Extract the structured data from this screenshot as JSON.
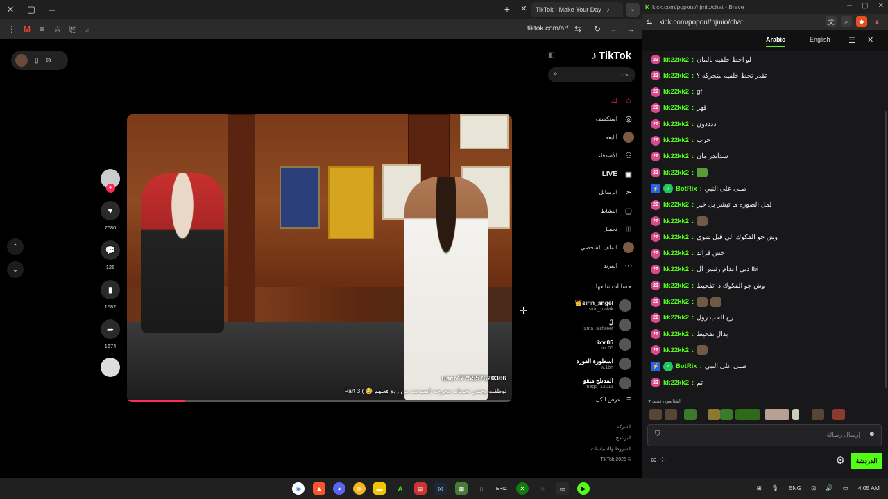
{
  "browser_left": {
    "tab_title": "TikTok - Make Your Day",
    "url": "tiktok.com/ar/"
  },
  "tiktok": {
    "logo": "TikTok",
    "search_placeholder": "بحث",
    "nav": [
      {
        "label": "لك",
        "icon": "home-icon"
      },
      {
        "label": "استكشف",
        "icon": "compass-icon"
      },
      {
        "label": "أتابعه",
        "icon": "avatar-icon"
      },
      {
        "label": "الأصدقاء",
        "icon": "friends-icon"
      },
      {
        "label": "LIVE",
        "icon": "live-icon"
      },
      {
        "label": "الرسائل",
        "icon": "send-icon"
      },
      {
        "label": "النشاط",
        "icon": "activity-icon"
      },
      {
        "label": "تحميل",
        "icon": "upload-icon"
      },
      {
        "label": "الملف الشخصي",
        "icon": "profile-icon"
      },
      {
        "label": "المزيد",
        "icon": "more-icon"
      }
    ],
    "following_title": "حسابات تتابعها",
    "following": [
      {
        "name": "👑sirin_angel",
        "handle": "sirin_malak"
      },
      {
        "name": "لَ",
        "handle": "lama_alshreef"
      },
      {
        "name": "ixv.05",
        "handle": "ixv.05"
      },
      {
        "name": "اسطورة الفورد",
        "handle": "w.1bh"
      },
      {
        "name": "المدبلج ميقو",
        "handle": "mego_12011"
      }
    ],
    "see_all": "عرض الكل",
    "footer": [
      "الشركة",
      "البرنامج",
      "الشروط والسياسات",
      "TikTok 2026 ©"
    ],
    "video": {
      "username": "user4775557620366",
      "caption": "توظفت وجتني تحديات محرجه (انصدمت من ردة فعلهم 😂 ) Part 3",
      "progress": 0.15
    },
    "counts": {
      "likes": "7680",
      "comments": "126",
      "saves": "1682",
      "shares": "1674"
    }
  },
  "browser_right": {
    "title": "kick.com/popout/njmio/chat - Brave",
    "url": "kick.com/popout/njmio/chat",
    "lang_active": "Arabic",
    "lang_other": "English"
  },
  "chat": {
    "messages": [
      {
        "user": "kk22kk2",
        "text": "لو احط خلفيه بالمان",
        "color": "#53fc18",
        "kind": "user"
      },
      {
        "user": "kk22kk2",
        "text": "تقدر تحط خلفيه متحركه ؟",
        "color": "#53fc18",
        "kind": "user"
      },
      {
        "user": "kk22kk2",
        "text": "gf",
        "color": "#53fc18",
        "kind": "user"
      },
      {
        "user": "kk22kk2",
        "text": "قهر",
        "color": "#53fc18",
        "kind": "user"
      },
      {
        "user": "kk22kk2",
        "text": "ددددون",
        "color": "#53fc18",
        "kind": "user"
      },
      {
        "user": "kk22kk2",
        "text": "حرب",
        "color": "#53fc18",
        "kind": "user"
      },
      {
        "user": "kk22kk2",
        "text": "سدايدر مان",
        "color": "#53fc18",
        "kind": "user"
      },
      {
        "user": "kk22kk2",
        "text": "",
        "color": "#53fc18",
        "kind": "user",
        "emote": 1
      },
      {
        "user": "BotRix",
        "text": "صلى على النبي",
        "color": "#53fc18",
        "kind": "bot"
      },
      {
        "user": "kk22kk2",
        "text": "لمل الصوره ما تيشر بل خير",
        "color": "#53fc18",
        "kind": "user"
      },
      {
        "user": "kk22kk2",
        "text": "",
        "color": "#53fc18",
        "kind": "user",
        "emote": 1
      },
      {
        "user": "kk22kk2",
        "text": "وش جو الفكوك الي قبل شوي",
        "color": "#53fc18",
        "kind": "user"
      },
      {
        "user": "kk22kk2",
        "text": "خش قرائد",
        "color": "#53fc18",
        "kind": "user"
      },
      {
        "user": "kk22kk2",
        "text": "دبي اعدام رئيس ال fbi",
        "color": "#53fc18",
        "kind": "user"
      },
      {
        "user": "kk22kk2",
        "text": "وش جو الفكوك ذا تفحيط",
        "color": "#53fc18",
        "kind": "user"
      },
      {
        "user": "kk22kk2",
        "text": "",
        "color": "#53fc18",
        "kind": "user",
        "emote": 2
      },
      {
        "user": "kk22kk2",
        "text": "رح الحب رول",
        "color": "#53fc18",
        "kind": "user"
      },
      {
        "user": "kk22kk2",
        "text": "بدال تفحيط",
        "color": "#53fc18",
        "kind": "user"
      },
      {
        "user": "kk22kk2",
        "text": "",
        "color": "#53fc18",
        "kind": "user",
        "emote": 1
      },
      {
        "user": "BotRix",
        "text": "صلى على النبي",
        "color": "#53fc18",
        "kind": "bot"
      },
      {
        "user": "kk22kk2",
        "text": "تم",
        "color": "#53fc18",
        "kind": "user"
      }
    ],
    "subs_only_label": "المتابعون فقط",
    "input_placeholder": "إرسال رسالة",
    "chat_button": "الدردشة"
  },
  "taskbar": {
    "lang": "ENG",
    "time": "4:05 AM"
  },
  "colors": {
    "kick_green": "#53fc18",
    "tiktok_red": "#fe2c55"
  }
}
